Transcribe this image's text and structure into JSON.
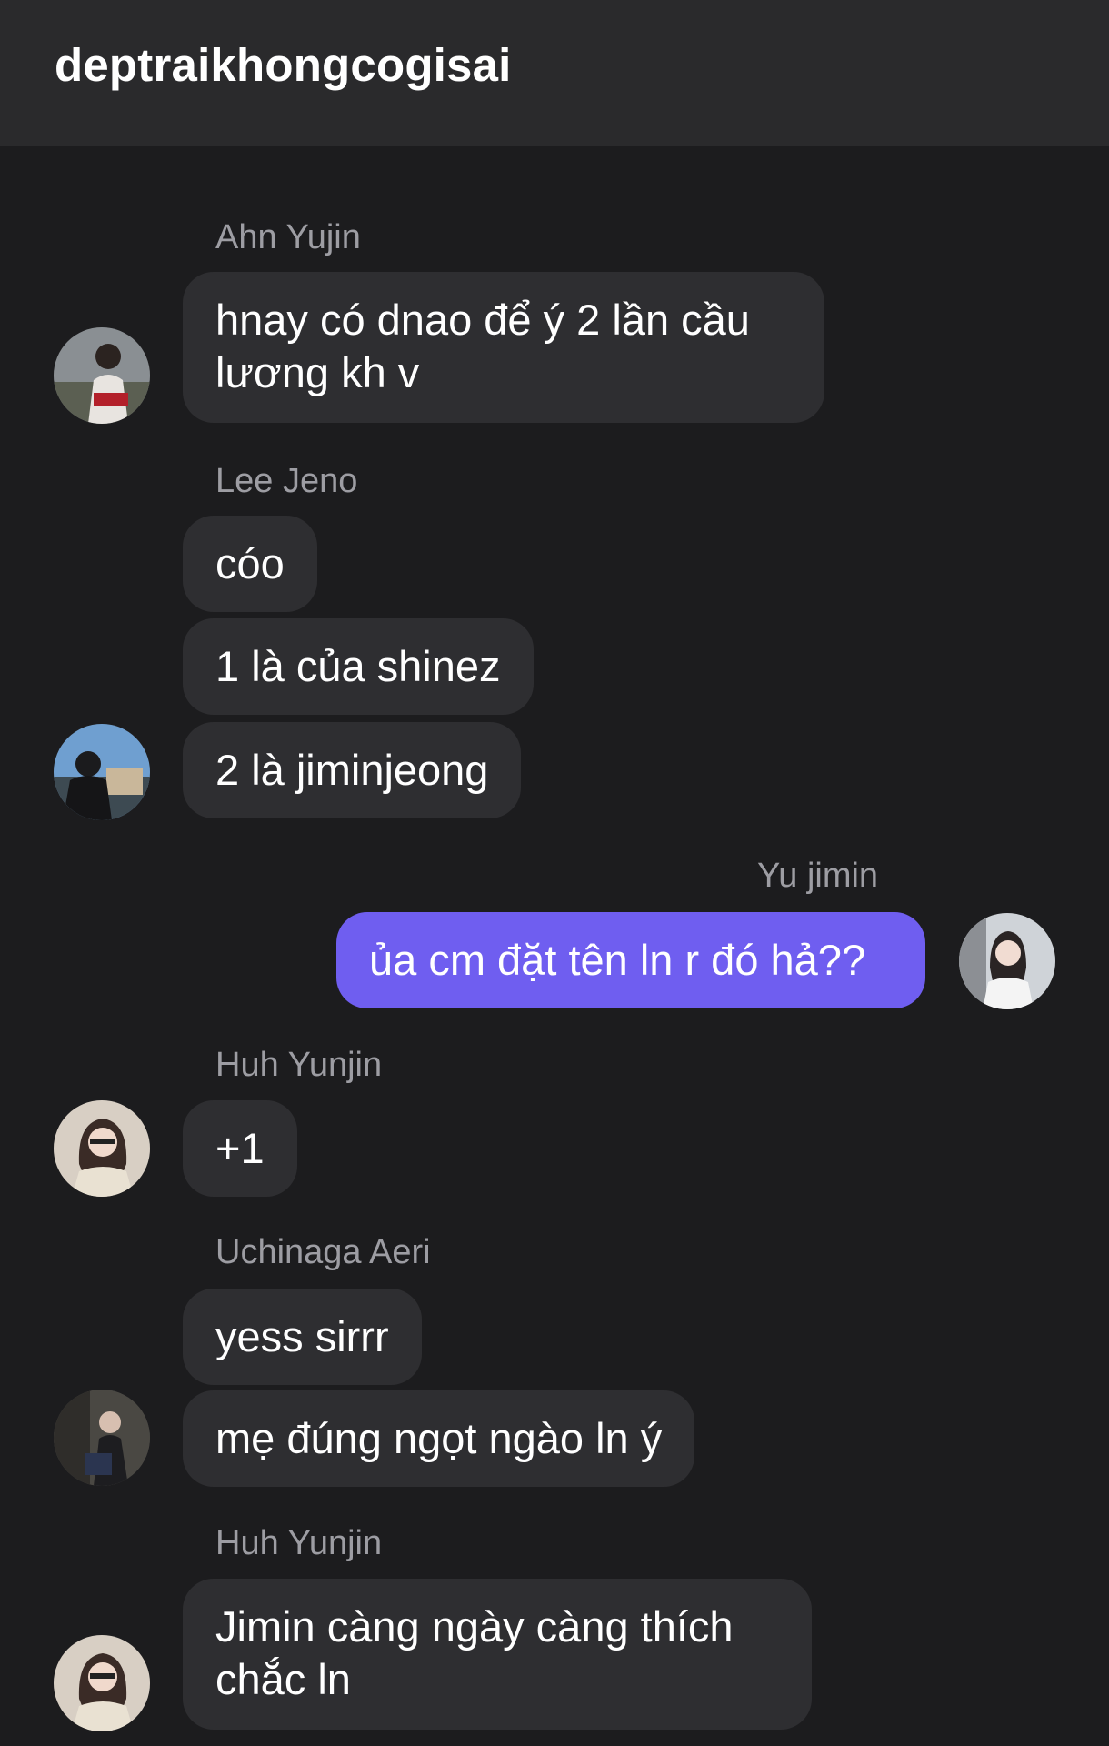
{
  "header": {
    "title": "deptraikhongcogisai"
  },
  "messages": [
    {
      "sender": "Ahn Yujin",
      "bubbles": [
        "hnay có dnao để ý 2 lần cầu lương kh v"
      ]
    },
    {
      "sender": "Lee Jeno",
      "bubbles": [
        "cóo",
        "1 là của shinez",
        "2 là jiminjeong"
      ]
    },
    {
      "sender": "Yu jimin",
      "bubbles": [
        "ủa cm đặt tên ln r đó hả??"
      ]
    },
    {
      "sender": "Huh Yunjin",
      "bubbles": [
        "+1"
      ]
    },
    {
      "sender": "Uchinaga Aeri",
      "bubbles": [
        "yess sirrr",
        "mẹ đúng ngọt ngào ln ý"
      ]
    },
    {
      "sender": "Huh Yunjin",
      "bubbles": [
        "Jimin càng ngày càng thích chắc ln"
      ]
    }
  ],
  "colors": {
    "background": "#1c1c1e",
    "header": "#2a2a2c",
    "bubble_other": "#2e2e31",
    "bubble_mine": "#6f5ef0",
    "sender_name": "#9d9da3"
  }
}
